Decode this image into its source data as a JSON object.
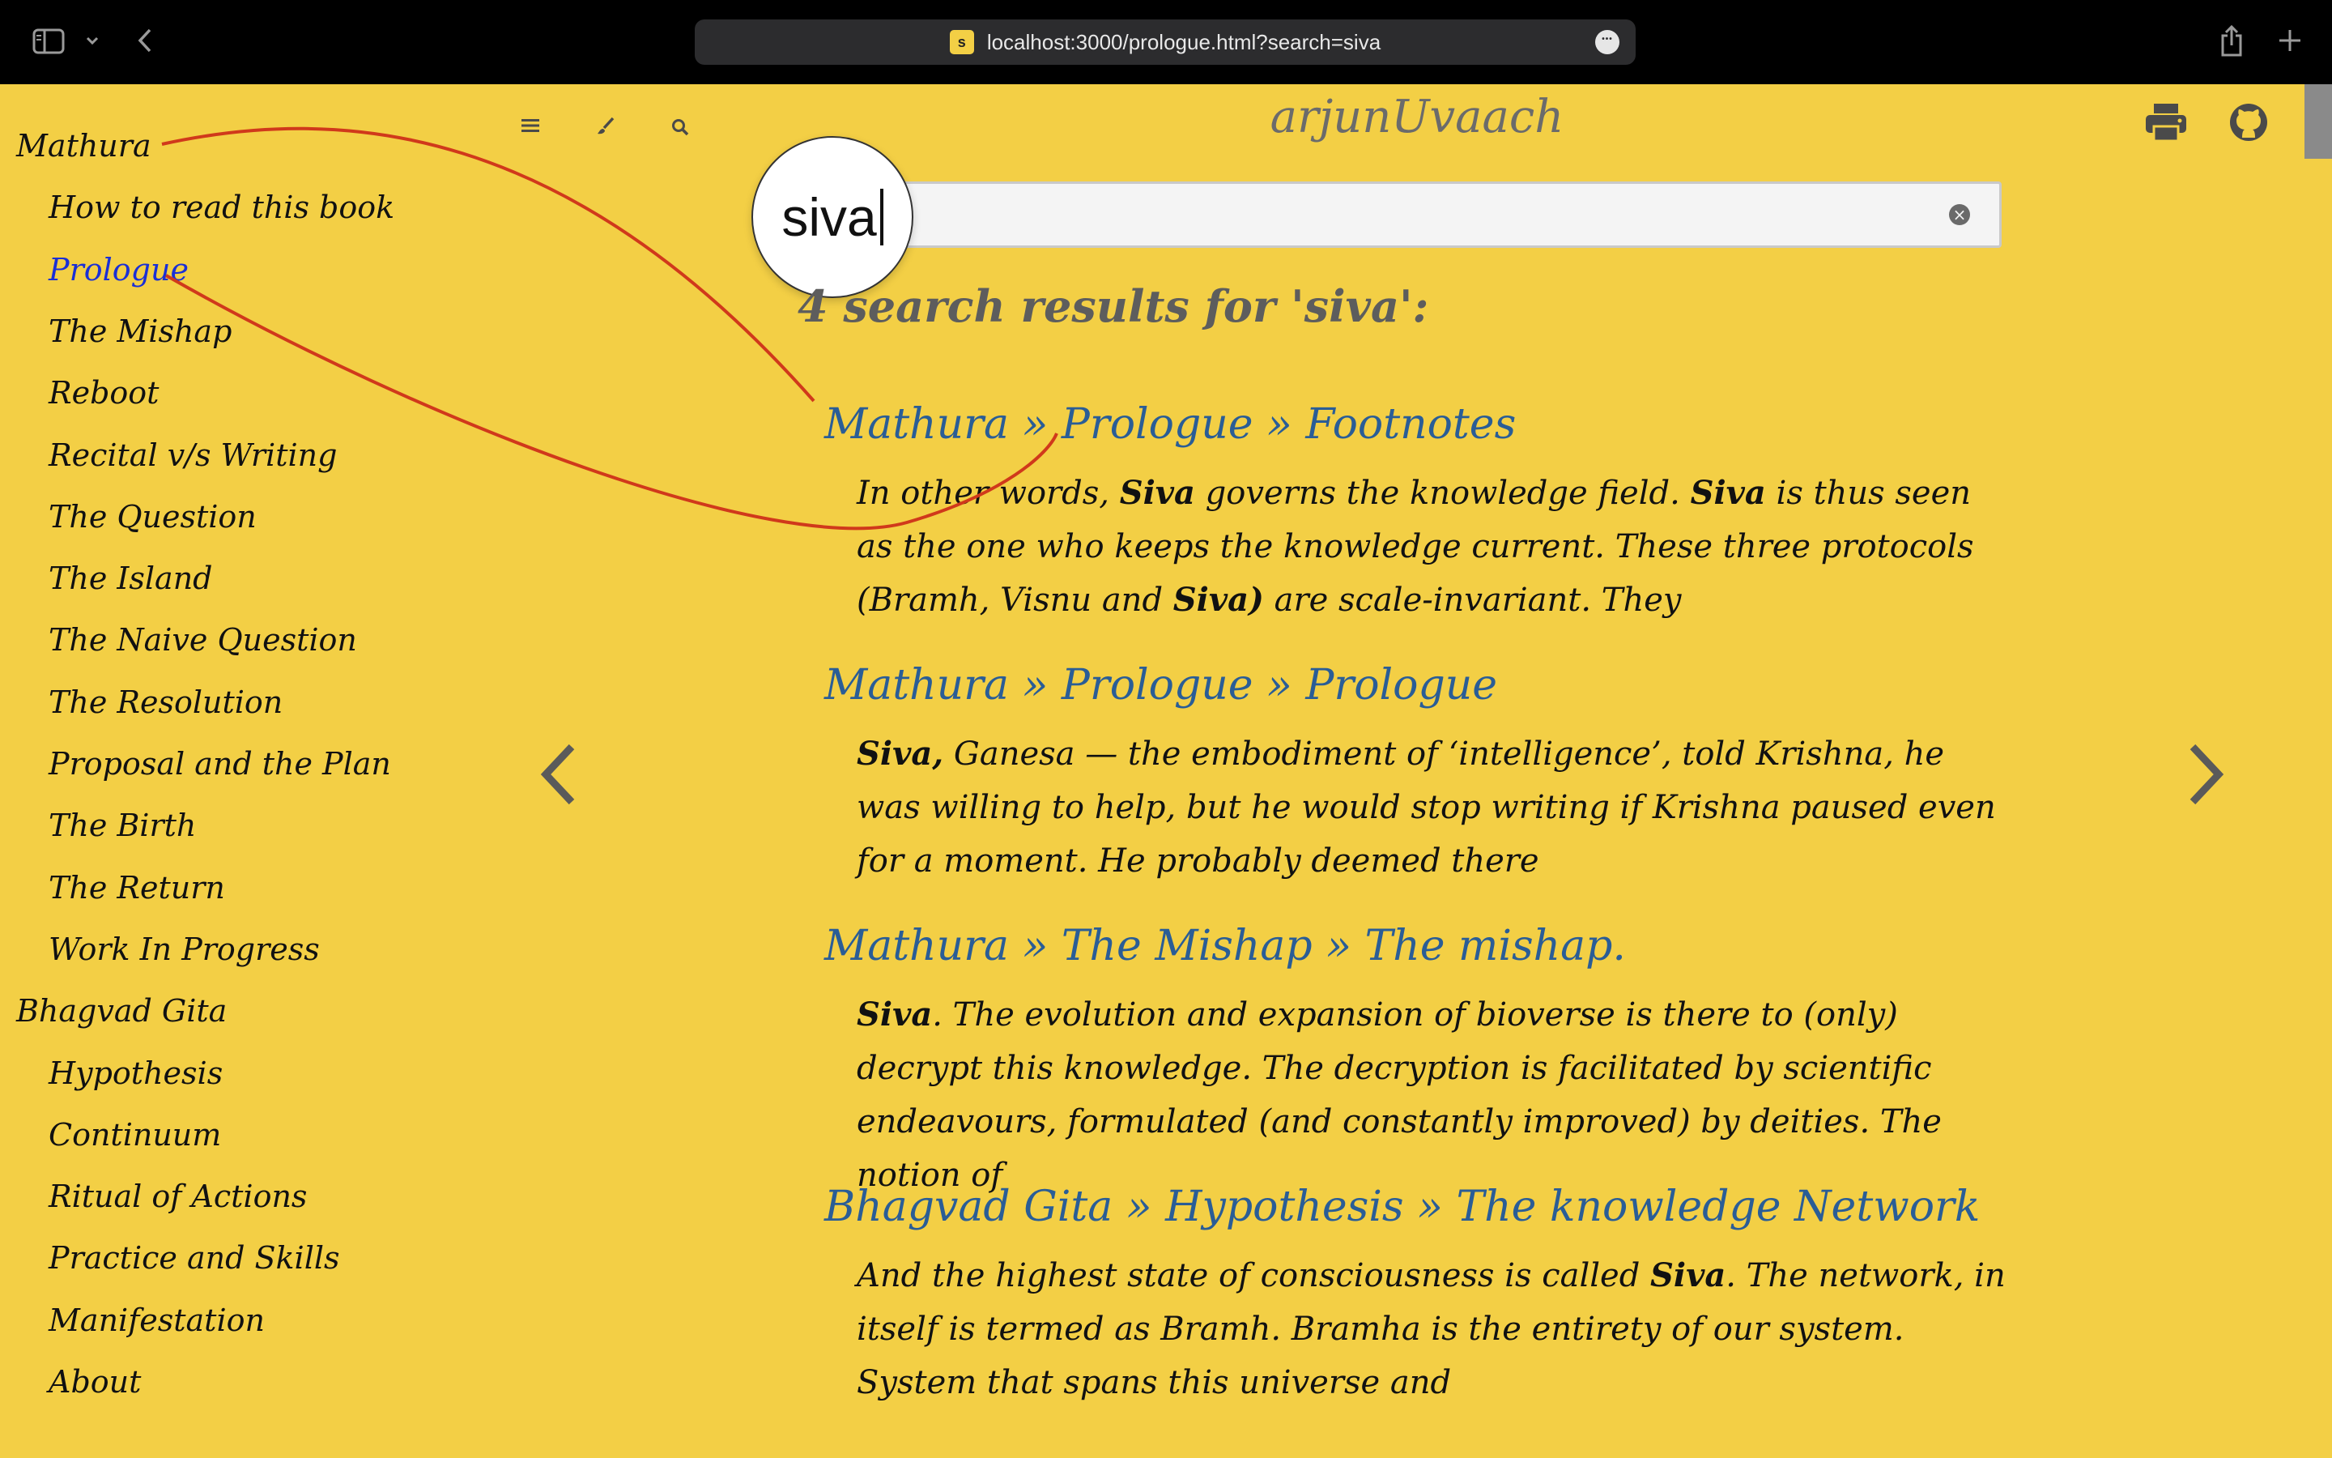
{
  "browser": {
    "url": "localhost:3000/prologue.html?search=siva",
    "favicon_letter": "s",
    "more_glyph": "•••"
  },
  "site": {
    "title": "arjunUvaach"
  },
  "sidebar": {
    "chapters": [
      {
        "label": "Mathura",
        "sections": [
          "How to read this book",
          "Prologue",
          "The Mishap",
          "Reboot",
          "Recital v/s Writing",
          "The Question",
          "The Island",
          "The Naive Question",
          "The Resolution",
          "Proposal and the Plan",
          "The Birth",
          "The Return",
          "Work In Progress"
        ]
      },
      {
        "label": "Bhagvad Gita",
        "sections": [
          "Hypothesis",
          "Continuum",
          "Ritual of Actions",
          "Practice and Skills",
          "Manifestation",
          "About"
        ]
      }
    ],
    "active": "Prologue"
  },
  "search": {
    "value": "siva",
    "results_header": "4 search results for 'siva':",
    "results": [
      {
        "title": "Mathura » Prologue » Footnotes",
        "parts": [
          {
            "t": "In other words, ",
            "b": false
          },
          {
            "t": "Siva",
            "b": true
          },
          {
            "t": " governs the knowledge field. ",
            "b": false
          },
          {
            "t": "Siva",
            "b": true
          },
          {
            "t": " is thus seen as the one who keeps the knowledge current. These three protocols (Bramh, Visnu and ",
            "b": false
          },
          {
            "t": "Siva)",
            "b": true
          },
          {
            "t": " are scale-invariant. They",
            "b": false
          }
        ]
      },
      {
        "title": "Mathura » Prologue » Prologue",
        "parts": [
          {
            "t": "Siva,",
            "b": true
          },
          {
            "t": " Ganesa — the embodiment of ‘intelligence’, told Krishna, he was willing to help, but he would stop writing if Krishna paused even for a moment. He probably deemed there",
            "b": false
          }
        ]
      },
      {
        "title": "Mathura » The Mishap » The mishap.",
        "parts": [
          {
            "t": "Siva",
            "b": true
          },
          {
            "t": ". The evolution and expansion of bioverse is there to (only) decrypt this knowledge. The decryption is facilitated by scientific endeavours, formulated (and constantly improved) by deities. The notion of",
            "b": false
          }
        ]
      },
      {
        "title": "Bhagvad Gita » Hypothesis » The knowledge Network",
        "parts": [
          {
            "t": "And the highest state of consciousness is called ",
            "b": false
          },
          {
            "t": "Siva",
            "b": true
          },
          {
            "t": ". The network, in itself is termed as Bramh. Bramha is the entirety of our system. System that spans this universe and",
            "b": false
          }
        ]
      }
    ]
  },
  "icons": {
    "sidebar_toggle": "sidebar-icon",
    "chevron": "chevron-down-icon",
    "back": "back-icon",
    "share": "share-icon",
    "new_tab": "plus-icon",
    "menu": "hamburger-icon",
    "theme": "brush-icon",
    "search": "search-icon",
    "print": "printer-icon",
    "github": "github-icon",
    "prev": "chevron-left-icon",
    "next": "chevron-right-icon",
    "clear": "clear-icon"
  }
}
